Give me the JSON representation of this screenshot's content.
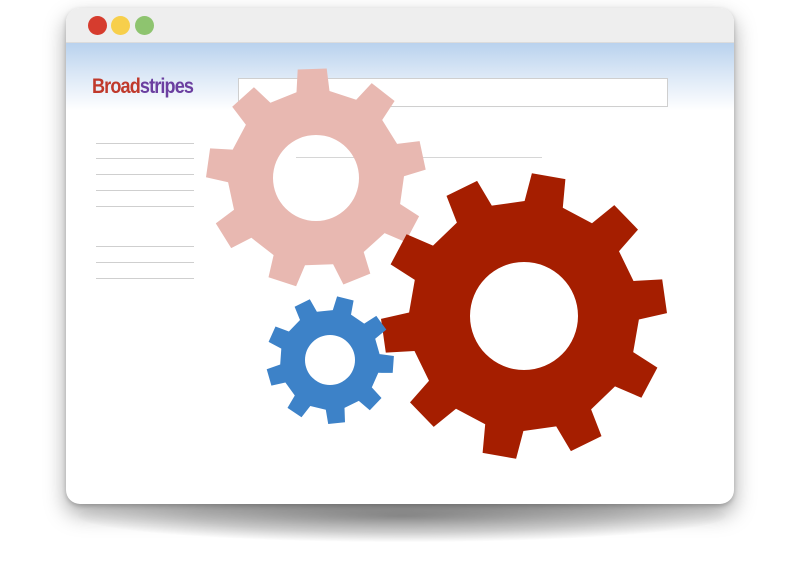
{
  "window": {
    "controls": [
      {
        "name": "close",
        "color": "#d63c2e"
      },
      {
        "name": "minimize",
        "color": "#f7cf4b"
      },
      {
        "name": "maximize",
        "color": "#8ec46f"
      }
    ]
  },
  "logo": {
    "part1": "Broad",
    "part2": "stripes",
    "color1": "#c0392b",
    "color2": "#6b3fa0"
  },
  "search": {
    "value": ""
  },
  "sidebar": {
    "item_count": 8
  },
  "illustration": {
    "gears": [
      {
        "name": "pink-gear-icon",
        "color": "#e8b8b1"
      },
      {
        "name": "red-gear-icon",
        "color": "#a51e00"
      },
      {
        "name": "blue-gear-icon",
        "color": "#3d82c8"
      }
    ]
  }
}
